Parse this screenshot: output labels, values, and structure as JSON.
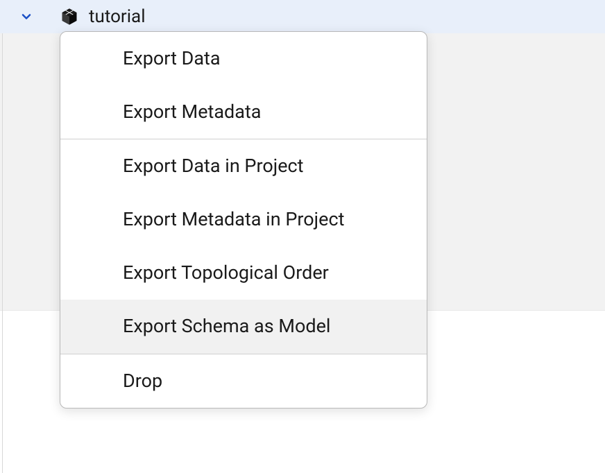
{
  "header": {
    "title": "tutorial"
  },
  "menu": {
    "groups": [
      [
        {
          "label": "Export Data",
          "hovered": false
        },
        {
          "label": "Export Metadata",
          "hovered": false
        }
      ],
      [
        {
          "label": "Export Data in Project",
          "hovered": false
        },
        {
          "label": "Export Metadata in Project",
          "hovered": false
        },
        {
          "label": "Export Topological Order",
          "hovered": false
        },
        {
          "label": "Export Schema as Model",
          "hovered": true
        }
      ],
      [
        {
          "label": "Drop",
          "hovered": false
        }
      ]
    ]
  }
}
